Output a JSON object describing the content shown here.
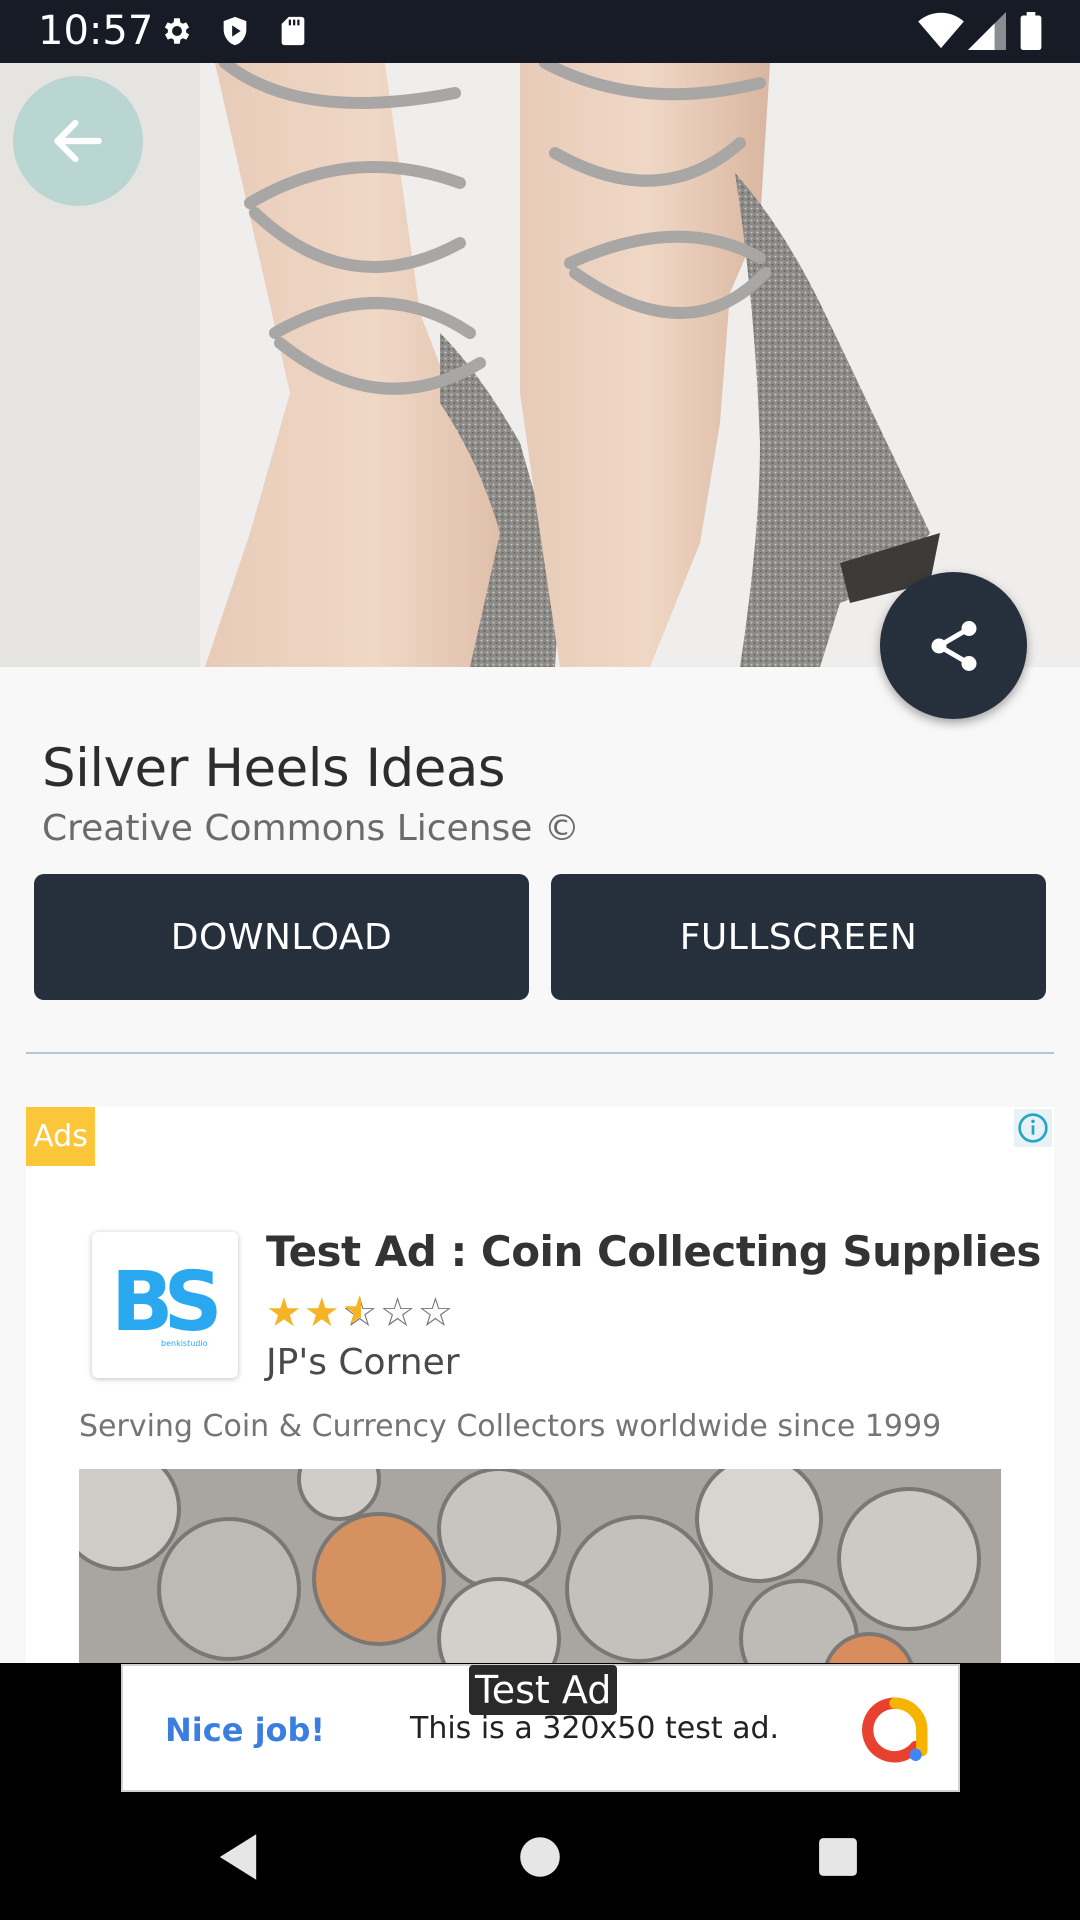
{
  "status_bar": {
    "time": "10:57",
    "icons": [
      "gear-icon",
      "shield-icon",
      "sd-card-icon",
      "wifi-icon",
      "signal-icon",
      "battery-icon"
    ]
  },
  "hero": {
    "image_subject": "silver lace-up block heels photo"
  },
  "wallpaper": {
    "title": "Silver Heels Ideas",
    "license": "Creative Commons License ©"
  },
  "actions": {
    "download_label": "DOWNLOAD",
    "fullscreen_label": "FULLSCREEN"
  },
  "native_ad": {
    "badge": "Ads",
    "headline": "Test Ad : Coin Collecting Supplies",
    "rating": 2.5,
    "rating_max": 5,
    "advertiser": "JP's Corner",
    "body": "Serving Coin & Currency Collectors worldwide since 1999",
    "logo_text": "BS",
    "logo_subtext": "benkistudio"
  },
  "banner_ad": {
    "tag": "Test Ad",
    "nice": "Nice job!",
    "text": "This is a 320x50 test ad."
  },
  "colors": {
    "dark": "#262f3c",
    "status_bar": "#161b26",
    "ads_badge": "#fbc63a",
    "star": "#f5b425",
    "banner_nice": "#3a7ee0",
    "back_button": "#b2d4cf"
  }
}
